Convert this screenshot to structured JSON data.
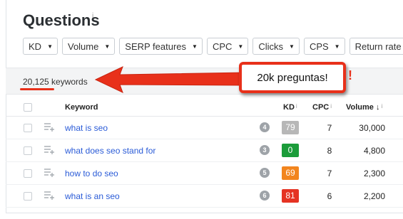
{
  "page": {
    "title": "Questions",
    "title_info": "i"
  },
  "filters": [
    {
      "label": "KD"
    },
    {
      "label": "Volume"
    },
    {
      "label": "SERP features"
    },
    {
      "label": "CPC"
    },
    {
      "label": "Clicks"
    },
    {
      "label": "CPS"
    },
    {
      "label": "Return rate"
    }
  ],
  "stats": {
    "keyword_count": "20,125 keywords"
  },
  "annotation": {
    "callout": "20k preguntas!",
    "exclaim": "!",
    "color": "#e8301a"
  },
  "table": {
    "headers": {
      "keyword": "Keyword",
      "kd": "KD",
      "cpc": "CPC",
      "volume": "Volume",
      "sort_icon": "↓",
      "info": "i"
    },
    "rows": [
      {
        "keyword": "what is seo",
        "serp_features": "4",
        "kd": "79",
        "kd_color": "#b7b7b7",
        "cpc": "7",
        "volume": "30,000"
      },
      {
        "keyword": "what does seo stand for",
        "serp_features": "3",
        "kd": "0",
        "kd_color": "#1b9c3a",
        "cpc": "8",
        "volume": "4,800"
      },
      {
        "keyword": "how to do seo",
        "serp_features": "5",
        "kd": "69",
        "kd_color": "#f2851e",
        "cpc": "7",
        "volume": "2,300"
      },
      {
        "keyword": "what is an seo",
        "serp_features": "6",
        "kd": "81",
        "kd_color": "#e53323",
        "cpc": "6",
        "volume": "2,200"
      }
    ]
  }
}
